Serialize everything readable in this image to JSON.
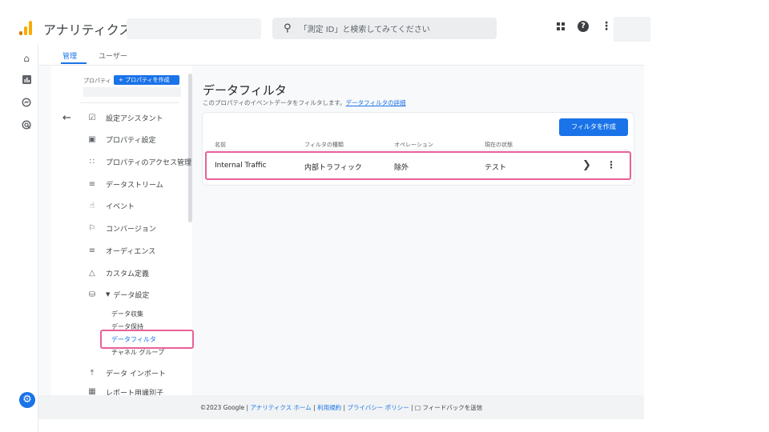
{
  "app": {
    "title": "アナリティクス"
  },
  "search": {
    "placeholder": "「測定 ID」と検索してみてください"
  },
  "tabs": [
    {
      "label": "管理",
      "active": true
    },
    {
      "label": "ユーザー",
      "active": false
    }
  ],
  "property": {
    "label": "プロパティ",
    "create_button": "+ プロパティを作成"
  },
  "nav": {
    "items": [
      {
        "label": "設定アシスタント",
        "icon": "checkbox-icon"
      },
      {
        "label": "プロパティ設定",
        "icon": "window-icon"
      },
      {
        "label": "プロパティのアクセス管理",
        "icon": "people-icon"
      },
      {
        "label": "データストリーム",
        "icon": "streams-icon"
      },
      {
        "label": "イベント",
        "icon": "touch-icon"
      },
      {
        "label": "コンバージョン",
        "icon": "flag-icon"
      },
      {
        "label": "オーディエンス",
        "icon": "audience-icon"
      },
      {
        "label": "カスタム定義",
        "icon": "shapes-icon"
      },
      {
        "label": "データ設定",
        "icon": "database-icon"
      }
    ],
    "data_settings_sub": [
      {
        "label": "データ収集",
        "active": false
      },
      {
        "label": "データ保持",
        "active": false
      },
      {
        "label": "データフィルタ",
        "active": true
      },
      {
        "label": "チャネル グループ",
        "active": false
      }
    ],
    "data_import": {
      "label": "データ インポート",
      "icon": "upload-icon"
    },
    "cut_item": {
      "label": "レポート用識別子"
    }
  },
  "page": {
    "title": "データフィルタ",
    "description": "このプロパティのイベントデータをフィルタします。",
    "description_link": "データフィルタの詳細"
  },
  "table": {
    "create_button": "フィルタを作成",
    "columns": [
      "名前",
      "フィルタの種類",
      "オペレーション",
      "現在の状態"
    ],
    "rows": [
      {
        "name": "Internal Traffic",
        "type": "内部トラフィック",
        "operation": "除外",
        "state": "テスト"
      }
    ]
  },
  "footer": {
    "copyright": "©2023 Google |",
    "home": "アナリティクス ホーム",
    "terms": "利用規約",
    "privacy": "プライバシー ポリシー",
    "feedback": "フィードバックを送信",
    "sep": "|"
  },
  "colors": {
    "accent": "#1a73e8",
    "highlight": "#e8609a",
    "logo_orange": "#f9ab00",
    "logo_dark": "#e37400"
  }
}
